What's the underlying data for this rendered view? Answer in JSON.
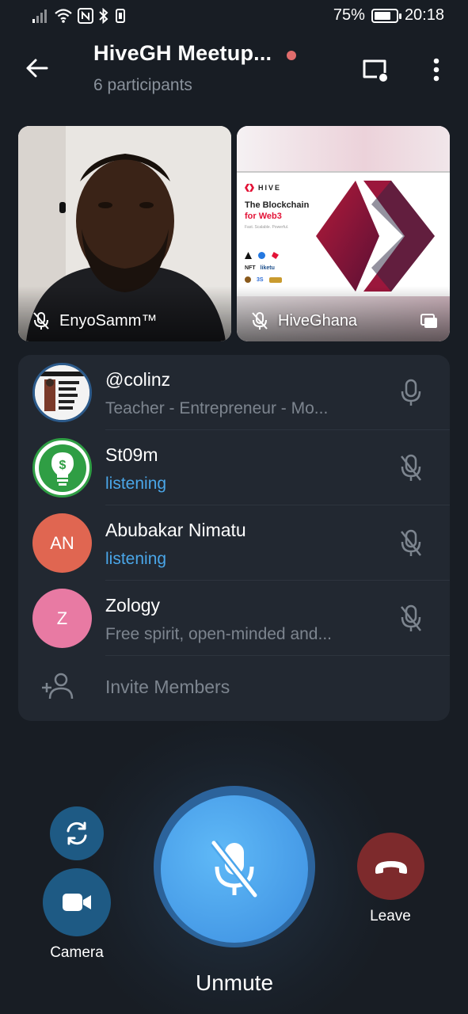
{
  "status_bar": {
    "battery": "75%",
    "battery_level": 0.75,
    "time": "20:18",
    "left_icons": [
      "signal-icon",
      "wifi-icon",
      "nfc-icon",
      "bluetooth-icon",
      "vibrate-icon"
    ]
  },
  "header": {
    "title": "HiveGH Meetup...",
    "subtitle": "6 participants"
  },
  "videos": [
    {
      "name": "EnyoSamm™"
    },
    {
      "name": "HiveGhana",
      "slide": {
        "brand": "HIVE",
        "headline_line1": "The Blockchain",
        "headline_line2": "for Web3",
        "tagline": "Fast. Scalable. Powerful.",
        "logos": [
          "NFT",
          "liketu",
          "3S"
        ]
      }
    }
  ],
  "participants": [
    {
      "name": "@colinz",
      "status": "Teacher - Entrepreneur - Mo...",
      "avatar_caption": "MATTER HOW YOU FEEL GET UP, DRESS UP, SHOW UP, AND NEVER GIVE UP"
    },
    {
      "name": "St09m",
      "status": "listening"
    },
    {
      "name": "Abubakar Nimatu",
      "status": "listening",
      "initials": "AN"
    },
    {
      "name": "Zology",
      "status": "Free spirit, open-minded and...",
      "initials": "Z"
    }
  ],
  "invite_label": "Invite Members",
  "controls": {
    "camera_label": "Camera",
    "unmute_label": "Unmute",
    "leave_label": "Leave"
  },
  "colors": {
    "background": "#181d24",
    "panel": "#222831",
    "accent_blue": "#4aa6e8",
    "unmute_blue": "#4ba6ec",
    "leave_red": "#7d2a2c",
    "avatar_an": "#e06651",
    "avatar_z": "#e87aa3",
    "avatar_st09m": "#2f9e44",
    "hive_red": "#e31337"
  }
}
